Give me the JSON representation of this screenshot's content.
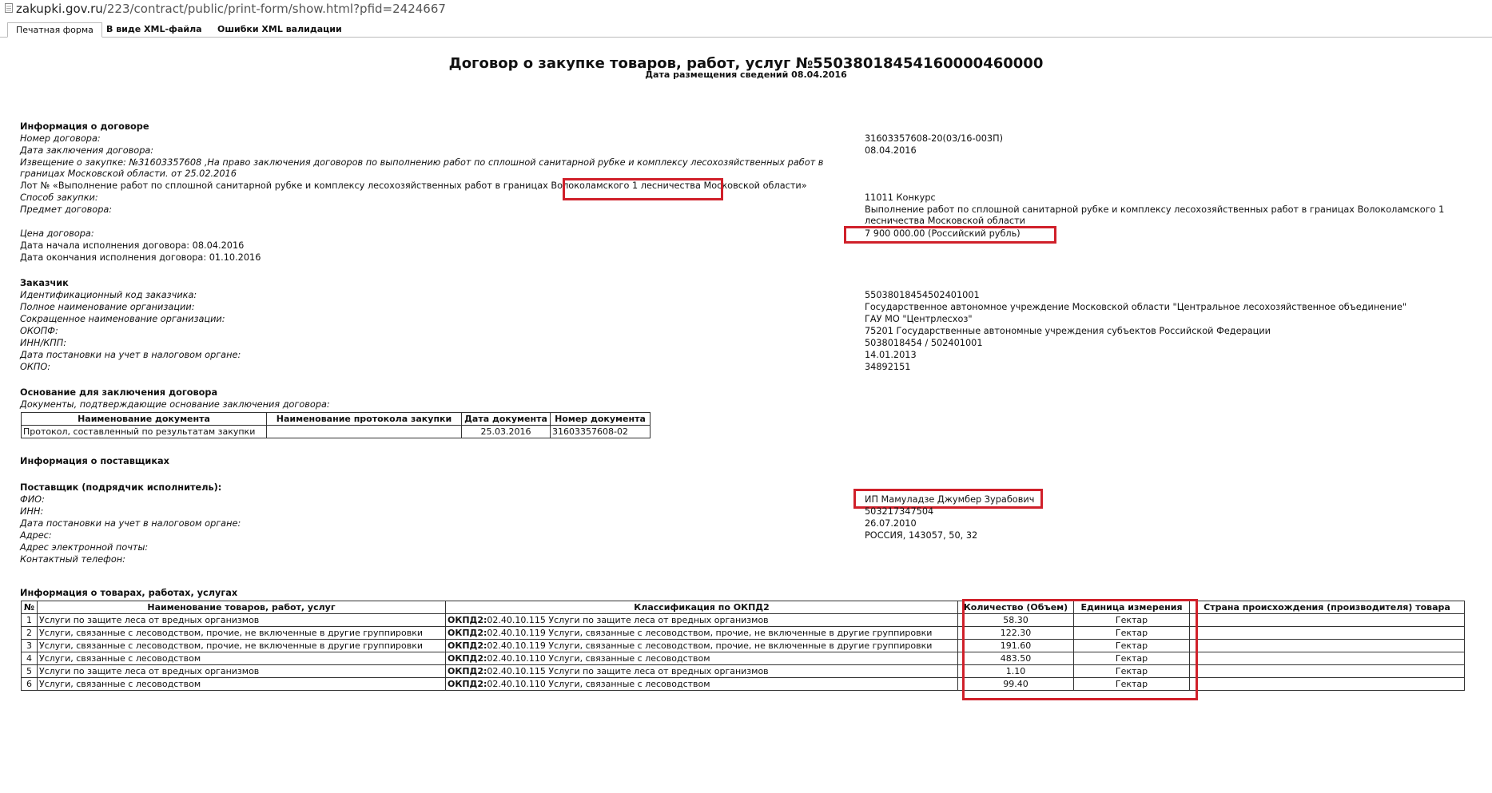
{
  "browser": {
    "url_host": "zakupki.gov.ru",
    "url_path": "/223/contract/public/print-form/show.html?pfid=2424667"
  },
  "tabs": [
    {
      "label": "Печатная форма",
      "active": true
    },
    {
      "label": "В виде XML-файла",
      "active": false
    },
    {
      "label": "Ошибки XML валидации",
      "active": false
    }
  ],
  "doc": {
    "title": "Договор о закупке товаров, работ, услуг №55038018454160000460000",
    "subtitle": "Дата размещения сведений 08.04.2016"
  },
  "contract_info": {
    "heading": "Информация о договоре",
    "number_label": "Номер договора:",
    "number_value": "31603357608-20(03/16-003П)",
    "date_label": "Дата заключения договора:",
    "date_value": "08.04.2016",
    "notice_line1": "Извещение о закупке: №31603357608 ,На право заключения договоров по выполнению работ по сплошной санитарной рубке и комплексу лесохозяйственных работ в",
    "notice_line2": "границах Московской области. от 25.02.2016",
    "lot_prefix": "Лот № «Выполнение работ по сплошной санитарной рубке и комплексу лесохозяйственных работ в границах ",
    "lot_highlight": "Волоколамского 1 лесничества",
    "lot_suffix": " Московской области»",
    "method_label": "Способ закупки:",
    "method_value": "11011 Конкурс",
    "subject_label": "Предмет договора:",
    "subject_value_line1": "Выполнение работ по сплошной санитарной рубке и комплексу лесохозяйственных работ в границах Волоколамского 1",
    "subject_value_line2": "лесничества Московской области",
    "price_label": "Цена договора:",
    "price_value": "7 900 000.00 (Российский рубль)",
    "start_label": "Дата начала исполнения договора: 08.04.2016",
    "end_label": "Дата окончания исполнения договора: 01.10.2016"
  },
  "customer": {
    "heading": "Заказчик",
    "id_label": "Идентификационный код заказчика:",
    "id_value": "55038018454502401001",
    "full_name_label": "Полное наименование организации:",
    "full_name_value": "Государственное автономное учреждение Московской области \"Центральное лесохозяйственное объединение\"",
    "short_name_label": "Сокращенное наименование организации:",
    "short_name_value": "ГАУ МО \"Центрлесхоз\"",
    "okopf_label": "ОКОПФ:",
    "okopf_value": "75201 Государственные автономные учреждения субъектов Российской Федерации",
    "inn_kpp_label": "ИНН/КПП:",
    "inn_kpp_value": "5038018454 / 502401001",
    "tax_date_label": "Дата постановки на учет в налоговом органе:",
    "tax_date_value": "14.01.2013",
    "okpo_label": "ОКПО:",
    "okpo_value": "34892151"
  },
  "basis": {
    "heading": "Основание для заключения договора",
    "docs_label": "Документы, подтверждающие основание заключения договора:",
    "columns": [
      "Наименование документа",
      "Наименование протокола закупки",
      "Дата документа",
      "Номер документа"
    ],
    "rows": [
      [
        "Протокол, составленный по результатам закупки",
        "",
        "25.03.2016",
        "31603357608-02"
      ]
    ]
  },
  "suppliers": {
    "heading": "Информация о поставщиках",
    "sub_heading": "Поставщик (подрядчик исполнитель):",
    "fio_label": "ФИО:",
    "fio_value": "ИП Мамуладзе Джумбер Зурабович",
    "inn_label": "ИНН:",
    "inn_value": "503217347504",
    "tax_date_label": "Дата постановки на учет в налоговом органе:",
    "tax_date_value": "26.07.2010",
    "address_label": "Адрес:",
    "address_value": "РОССИЯ, 143057, 50, 32",
    "email_label": "Адрес электронной почты:",
    "phone_label": "Контактный телефон:"
  },
  "goods": {
    "heading": "Информация о товарах, работах, услугах",
    "columns": [
      "№",
      "Наименование товаров, работ, услуг",
      "Классификация по ОКПД2",
      "Количество (Объем)",
      "Единица измерения",
      "Страна происхождения (производителя) товара"
    ],
    "okpd_prefix": "ОКПД2:",
    "rows": [
      {
        "n": "1",
        "name": "Услуги по защите леса от вредных организмов",
        "okpd": "02.40.10.115 Услуги по защите леса от вредных организмов",
        "qty": "58.30",
        "unit": "Гектар",
        "country": ""
      },
      {
        "n": "2",
        "name": "Услуги, связанные с лесоводством, прочие, не включенные в другие группировки",
        "okpd": "02.40.10.119 Услуги, связанные с лесоводством, прочие, не включенные в другие группировки",
        "qty": "122.30",
        "unit": "Гектар",
        "country": ""
      },
      {
        "n": "3",
        "name": "Услуги, связанные с лесоводством, прочие, не включенные в другие группировки",
        "okpd": "02.40.10.119 Услуги, связанные с лесоводством, прочие, не включенные в другие группировки",
        "qty": "191.60",
        "unit": "Гектар",
        "country": ""
      },
      {
        "n": "4",
        "name": "Услуги, связанные с лесоводством",
        "okpd": "02.40.10.110 Услуги, связанные с лесоводством",
        "qty": "483.50",
        "unit": "Гектар",
        "country": ""
      },
      {
        "n": "5",
        "name": "Услуги по защите леса от вредных организмов",
        "okpd": "02.40.10.115 Услуги по защите леса от вредных организмов",
        "qty": "1.10",
        "unit": "Гектар",
        "country": ""
      },
      {
        "n": "6",
        "name": "Услуги, связанные с лесоводством",
        "okpd": "02.40.10.110 Услуги, связанные с лесоводством",
        "qty": "99.40",
        "unit": "Гектар",
        "country": ""
      }
    ]
  },
  "highlight_color": "#d0202a"
}
